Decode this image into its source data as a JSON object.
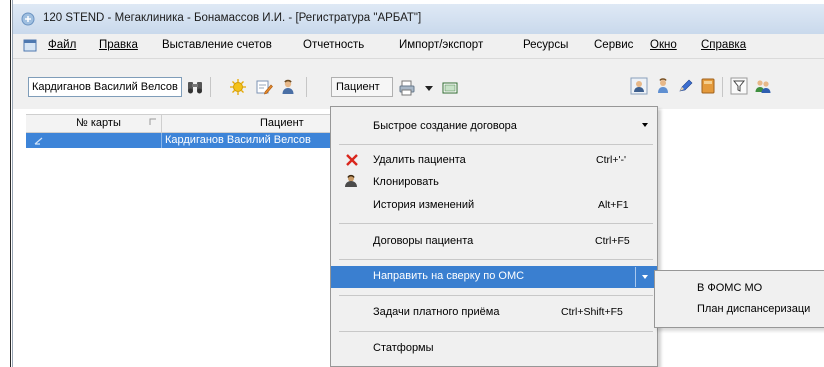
{
  "window": {
    "title": "120 STEND - Мегаклиника - Бонамассов И.И. - [Регистратура \"АРБАТ\"]"
  },
  "menubar": {
    "items": [
      {
        "label": "Файл",
        "underline_first": true
      },
      {
        "label": "Правка",
        "underline_first": true
      },
      {
        "label": "Выставление счетов",
        "underline_first": false
      },
      {
        "label": "Отчетность",
        "underline_first": false
      },
      {
        "label": "Импорт/экспорт",
        "underline_first": false
      },
      {
        "label": "Ресурсы",
        "underline_first": false
      },
      {
        "label": "Сервис",
        "underline_first": false
      },
      {
        "label": "Окно",
        "underline_first": true
      },
      {
        "label": "Справка",
        "underline_first": true
      }
    ]
  },
  "toolbar": {
    "patient_search_value": "Кардиганов Василий Велсов",
    "patient_button_label": "Пациент"
  },
  "grid": {
    "columns": [
      "№ карты",
      "Пациент"
    ],
    "rows": [
      {
        "card_number": "",
        "patient": "Кардиганов Василий Велсов"
      }
    ]
  },
  "context_menu": {
    "items": [
      {
        "label": "Быстрое создание договора",
        "shortcut": "",
        "has_submenu": true
      },
      {
        "label": "Удалить пациента",
        "shortcut": "Ctrl+'-'",
        "icon": "delete-x-icon"
      },
      {
        "label": "Клонировать",
        "shortcut": "",
        "icon": "person-icon"
      },
      {
        "label": "История изменений",
        "shortcut": "Alt+F1"
      },
      {
        "label": "Договоры пациента",
        "shortcut": "Ctrl+F5"
      },
      {
        "label": "Направить на сверку по ОМС",
        "shortcut": "",
        "has_submenu": true,
        "highlighted": true
      },
      {
        "label": "Задачи платного приёма",
        "shortcut": "Ctrl+Shift+F5"
      },
      {
        "label": "Статформы",
        "shortcut": ""
      }
    ]
  },
  "submenu": {
    "items": [
      {
        "label": "В ФОМС МО"
      },
      {
        "label": "План диспансеризаци"
      }
    ]
  },
  "colors": {
    "highlight": "#3a7fd0",
    "selected_row": "#3d84d8",
    "menu_bg": "#f0f0f0"
  }
}
